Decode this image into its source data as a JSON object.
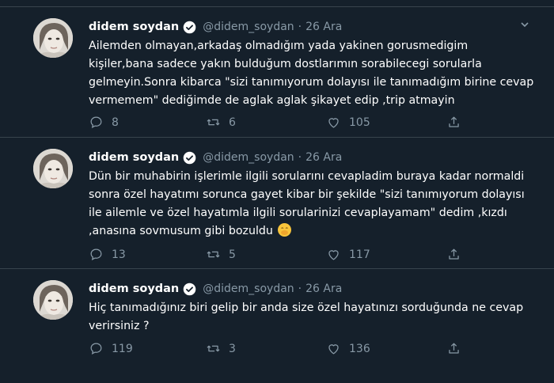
{
  "tweets": [
    {
      "name": "didem soydan",
      "handle": "@didem_soydan",
      "separator": "·",
      "date": "26 Ara",
      "lines": [
        "Ailemden olmayan,arkadaş olmadığım yada yakinen gorusmedigim",
        "kişiler,bana sadece yakın bulduğum dostlarımın  sorabilecegi sorularla",
        "gelmeyin.Sonra kibarca \"sizi tanımıyorum dolayısı ile tanımadığım birine cevap",
        "vermemem\" dediğimde de aglak aglak şikayet edip ,trip atmayin"
      ],
      "replies": "8",
      "retweets": "6",
      "likes": "105"
    },
    {
      "name": "didem soydan",
      "handle": "@didem_soydan",
      "separator": "·",
      "date": "26 Ara",
      "lines": [
        "Dün bir muhabirin işlerimle ilgili sorularını cevapladim buraya kadar normaldi",
        "sonra özel hayatımı sorunca gayet kibar bir şekilde \"sizi tanımıyorum dolayısı",
        "ile ailemle ve özel hayatımla ilgili sorularinizi cevaplayamam\" dedim ,kızdı",
        ",anasına sovmusum gibi bozuldu"
      ],
      "emoji": "face-with-hand-over-mouth-emoji",
      "replies": "13",
      "retweets": "5",
      "likes": "117"
    },
    {
      "name": "didem soydan",
      "handle": "@didem_soydan",
      "separator": "·",
      "date": "26 Ara",
      "lines": [
        "Hiç tanımadığınız biri gelip bir anda size özel hayatınızı sorduğunda ne cevap",
        "verirsiniz ?"
      ],
      "replies": "119",
      "retweets": "3",
      "likes": "136"
    }
  ],
  "colors": {
    "background": "#15202b",
    "divider": "#38444d",
    "muted": "#8899a6",
    "verified": "#1da1f2"
  }
}
